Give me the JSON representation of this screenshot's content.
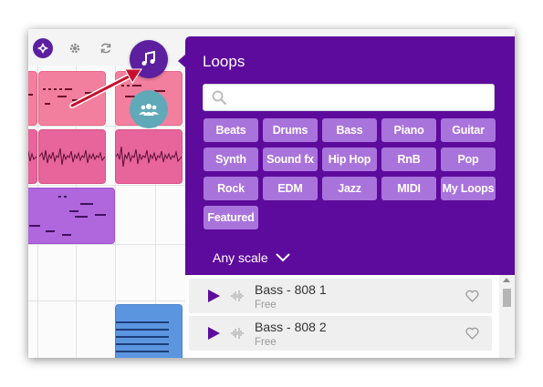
{
  "toolbar": {
    "icons": [
      "logo-icon",
      "gear-icon",
      "refresh-icon"
    ]
  },
  "floating_buttons": {
    "music": "music-note-icon",
    "collaborate": "people-icon"
  },
  "loops_panel": {
    "title": "Loops",
    "search": {
      "value": "",
      "placeholder": ""
    },
    "genres": [
      "Beats",
      "Drums",
      "Bass",
      "Piano",
      "Guitar",
      "Synth",
      "Sound fx",
      "Hip Hop",
      "RnB",
      "Pop",
      "Rock",
      "EDM",
      "Jazz",
      "MIDI",
      "My Loops",
      "Featured"
    ],
    "scale_filter": "Any scale",
    "loops": [
      {
        "name": "Bass - 808 1",
        "subtitle": "Free"
      },
      {
        "name": "Bass - 808 2",
        "subtitle": "Free"
      }
    ]
  },
  "colors": {
    "panel_bg": "#5d0b9c",
    "genre_button": "#a973dc",
    "accent_purple": "#5c1fa0",
    "clip_pink": "#f37f9e",
    "clip_magenta": "#e7659a",
    "clip_purple": "#b066dc",
    "clip_blue": "#5b95df",
    "collab_teal": "#5fa9b8",
    "arrow_red": "#c8102e"
  }
}
